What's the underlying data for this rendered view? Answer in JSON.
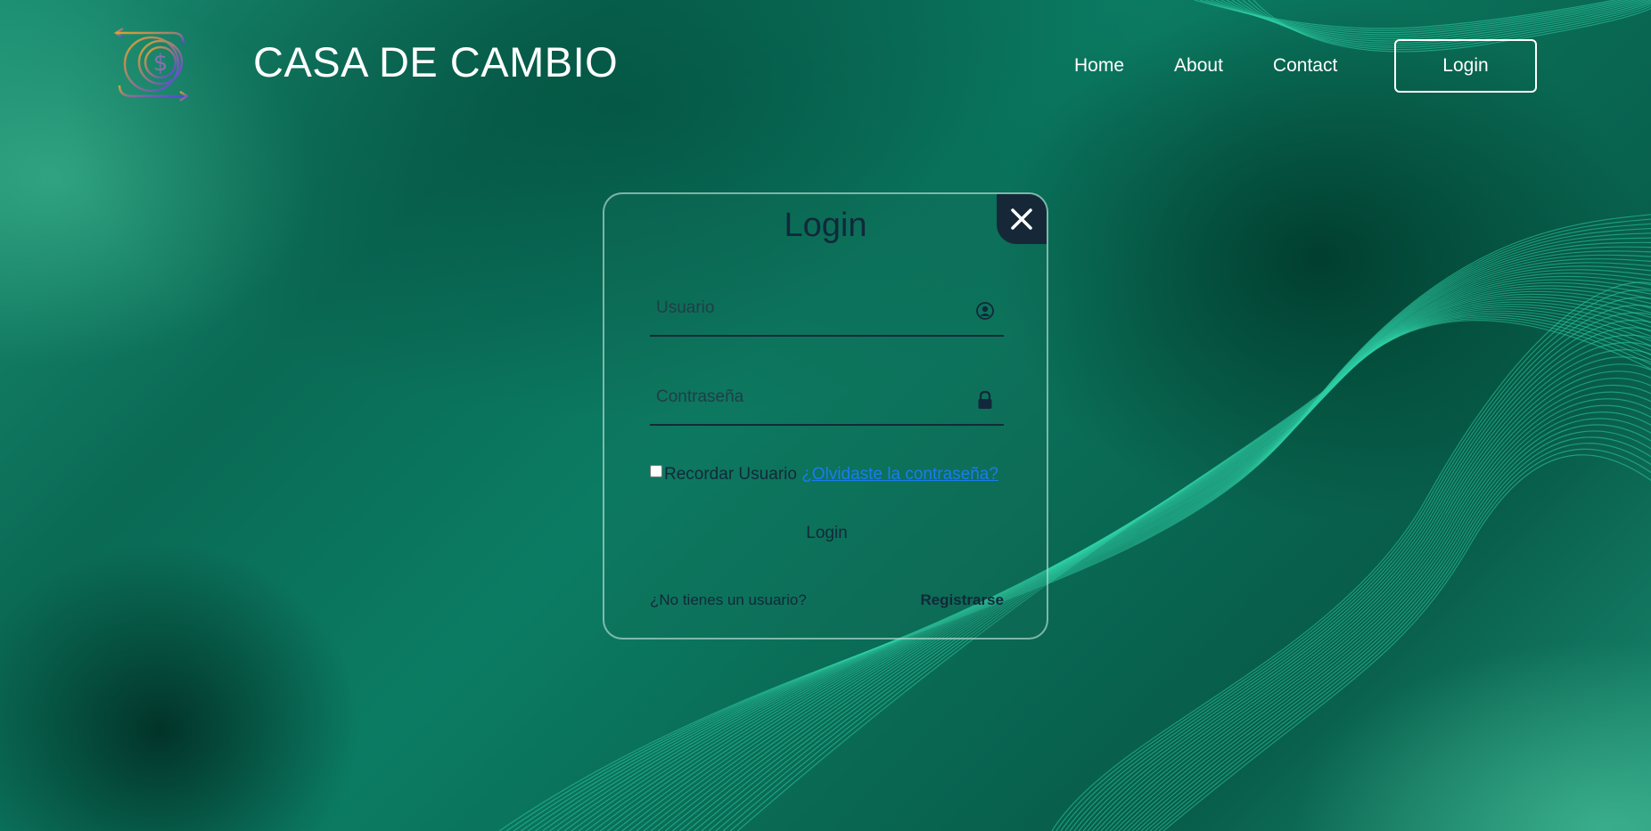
{
  "header": {
    "brand": "CASA DE CAMBIO",
    "nav": {
      "home": "Home",
      "about": "About",
      "contact": "Contact",
      "login": "Login"
    }
  },
  "modal": {
    "title": "Login",
    "close_icon": "close-icon",
    "username": {
      "placeholder": "Usuario",
      "value": "",
      "icon": "user-icon"
    },
    "password": {
      "placeholder": "Contraseña",
      "value": "",
      "icon": "lock-icon"
    },
    "remember_label": "Recordar Usuario",
    "remember_checked": false,
    "forgot_link": "¿Olvidaste la contraseña?",
    "submit_label": "Login",
    "no_account_text": "¿No tienes un usuario?",
    "register_link": "Registrarse"
  },
  "colors": {
    "accent_dark": "#162838",
    "link": "#1a7cf0",
    "background": "#0a6d56",
    "line_accent": "#2fcfa6"
  }
}
